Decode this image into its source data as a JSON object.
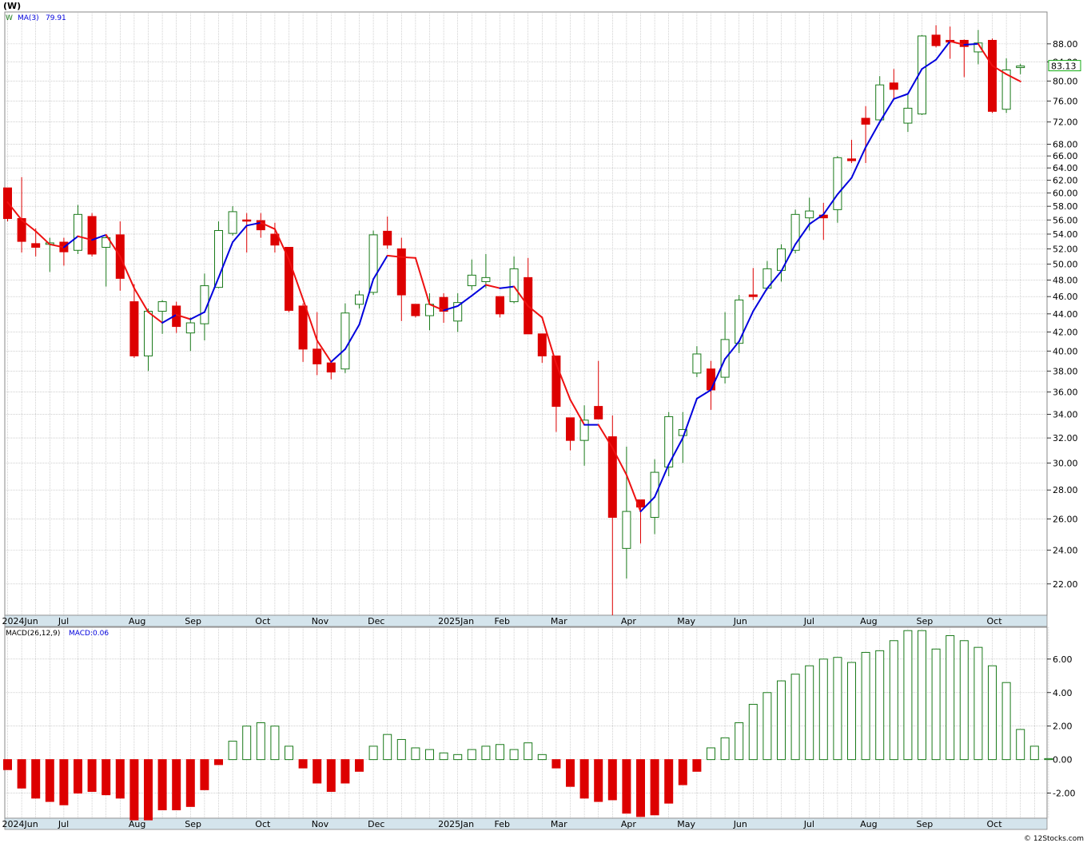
{
  "chart_data": {
    "type": "candlestick",
    "ticker": "(W)",
    "colors": {
      "up": "#1a7a1a",
      "down": "#dd0000",
      "ma_up": "#0000dd",
      "ma_down": "#ee1111",
      "macd_pos": "#1a7a1a",
      "macd_neg": "#dd0000",
      "grid": "#b4b4b4",
      "axis_bar": "#d4e4ec",
      "price_tag": "#11aa11"
    },
    "price_panel": {
      "legend": {
        "symbol": "W",
        "ma_label": "MA(3)",
        "ma_value": "79.91"
      },
      "y_scale": "log",
      "y_range": [
        20.3,
        95.5
      ],
      "y_ticks": [
        "22.00",
        "24.00",
        "26.00",
        "28.00",
        "30.00",
        "32.00",
        "34.00",
        "36.00",
        "38.00",
        "40.00",
        "42.00",
        "44.00",
        "46.00",
        "48.00",
        "50.00",
        "52.00",
        "54.00",
        "56.00",
        "58.00",
        "60.00",
        "62.00",
        "64.00",
        "66.00",
        "68.00",
        "72.00",
        "76.00",
        "80.00",
        "84.00",
        "88.00"
      ],
      "last_price": "83.13",
      "x_labels": [
        {
          "text": "2024Jun",
          "i": 0
        },
        {
          "text": "Jul",
          "i": 4
        },
        {
          "text": "Aug",
          "i": 9
        },
        {
          "text": "Sep",
          "i": 13
        },
        {
          "text": "Oct",
          "i": 18
        },
        {
          "text": "Nov",
          "i": 22
        },
        {
          "text": "Dec",
          "i": 26
        },
        {
          "text": "2025Jan",
          "i": 31
        },
        {
          "text": "Feb",
          "i": 35
        },
        {
          "text": "Mar",
          "i": 39
        },
        {
          "text": "Apr",
          "i": 44
        },
        {
          "text": "May",
          "i": 48
        },
        {
          "text": "Jun",
          "i": 52
        },
        {
          "text": "Jul",
          "i": 57
        },
        {
          "text": "Aug",
          "i": 61
        },
        {
          "text": "Sep",
          "i": 65
        },
        {
          "text": "Oct",
          "i": 70
        }
      ],
      "candles": [
        {
          "o": 60.8,
          "h": 60.8,
          "l": 55.8,
          "c": 56.2
        },
        {
          "o": 56.2,
          "h": 62.5,
          "l": 51.5,
          "c": 53.0
        },
        {
          "o": 52.7,
          "h": 54.8,
          "l": 51.0,
          "c": 52.2
        },
        {
          "o": 52.6,
          "h": 53.5,
          "l": 49.0,
          "c": 52.8
        },
        {
          "o": 52.9,
          "h": 53.5,
          "l": 49.8,
          "c": 51.6
        },
        {
          "o": 51.8,
          "h": 58.2,
          "l": 51.3,
          "c": 56.8
        },
        {
          "o": 56.5,
          "h": 57.0,
          "l": 51.0,
          "c": 51.3
        },
        {
          "o": 52.2,
          "h": 54.0,
          "l": 47.2,
          "c": 53.5
        },
        {
          "o": 53.9,
          "h": 55.8,
          "l": 46.7,
          "c": 48.2
        },
        {
          "o": 45.4,
          "h": 47.5,
          "l": 39.3,
          "c": 39.5
        },
        {
          "o": 39.5,
          "h": 44.6,
          "l": 38.0,
          "c": 44.3
        },
        {
          "o": 44.3,
          "h": 45.6,
          "l": 41.8,
          "c": 45.4
        },
        {
          "o": 44.9,
          "h": 45.4,
          "l": 41.9,
          "c": 42.6
        },
        {
          "o": 41.9,
          "h": 43.6,
          "l": 40.0,
          "c": 43.0
        },
        {
          "o": 42.9,
          "h": 48.8,
          "l": 41.1,
          "c": 47.3
        },
        {
          "o": 47.1,
          "h": 55.8,
          "l": 47.0,
          "c": 54.5
        },
        {
          "o": 54.1,
          "h": 58.0,
          "l": 53.8,
          "c": 57.2
        },
        {
          "o": 56.0,
          "h": 57.0,
          "l": 51.5,
          "c": 55.9
        },
        {
          "o": 55.9,
          "h": 57.0,
          "l": 53.5,
          "c": 54.6
        },
        {
          "o": 54.0,
          "h": 55.6,
          "l": 51.5,
          "c": 52.5
        },
        {
          "o": 52.2,
          "h": 52.2,
          "l": 44.2,
          "c": 44.4
        },
        {
          "o": 44.9,
          "h": 45.2,
          "l": 38.9,
          "c": 40.2
        },
        {
          "o": 40.2,
          "h": 44.2,
          "l": 37.6,
          "c": 38.7
        },
        {
          "o": 38.8,
          "h": 38.9,
          "l": 37.2,
          "c": 37.9
        },
        {
          "o": 38.2,
          "h": 45.2,
          "l": 37.8,
          "c": 44.1
        },
        {
          "o": 45.1,
          "h": 46.7,
          "l": 44.6,
          "c": 46.2
        },
        {
          "o": 46.5,
          "h": 54.5,
          "l": 46.2,
          "c": 53.9
        },
        {
          "o": 54.4,
          "h": 56.5,
          "l": 52.0,
          "c": 52.5
        },
        {
          "o": 52.0,
          "h": 53.5,
          "l": 43.2,
          "c": 46.2
        },
        {
          "o": 45.1,
          "h": 45.1,
          "l": 43.6,
          "c": 43.8
        },
        {
          "o": 43.8,
          "h": 46.4,
          "l": 42.2,
          "c": 45.1
        },
        {
          "o": 45.9,
          "h": 46.4,
          "l": 43.0,
          "c": 44.3
        },
        {
          "o": 43.2,
          "h": 46.4,
          "l": 42.0,
          "c": 45.3
        },
        {
          "o": 47.3,
          "h": 50.6,
          "l": 46.8,
          "c": 48.6
        },
        {
          "o": 47.8,
          "h": 51.3,
          "l": 47.0,
          "c": 48.3
        },
        {
          "o": 46.0,
          "h": 46.0,
          "l": 43.6,
          "c": 44.0
        },
        {
          "o": 45.4,
          "h": 51.0,
          "l": 45.2,
          "c": 49.4
        },
        {
          "o": 48.3,
          "h": 50.8,
          "l": 41.8,
          "c": 41.8
        },
        {
          "o": 41.8,
          "h": 41.8,
          "l": 38.8,
          "c": 39.5
        },
        {
          "o": 39.5,
          "h": 39.5,
          "l": 32.5,
          "c": 34.7
        },
        {
          "o": 33.7,
          "h": 33.7,
          "l": 31.0,
          "c": 31.8
        },
        {
          "o": 31.8,
          "h": 34.8,
          "l": 29.8,
          "c": 33.5
        },
        {
          "o": 34.7,
          "h": 39.0,
          "l": 33.6,
          "c": 33.6
        },
        {
          "o": 32.1,
          "h": 33.9,
          "l": 20.3,
          "c": 26.1
        },
        {
          "o": 24.1,
          "h": 31.3,
          "l": 22.3,
          "c": 26.5
        },
        {
          "o": 27.3,
          "h": 27.3,
          "l": 24.4,
          "c": 26.8
        },
        {
          "o": 26.1,
          "h": 30.3,
          "l": 25.0,
          "c": 29.3
        },
        {
          "o": 29.7,
          "h": 34.2,
          "l": 29.0,
          "c": 33.8
        },
        {
          "o": 32.2,
          "h": 34.2,
          "l": 30.0,
          "c": 32.7
        },
        {
          "o": 37.8,
          "h": 40.5,
          "l": 37.4,
          "c": 39.7
        },
        {
          "o": 38.2,
          "h": 39.0,
          "l": 34.4,
          "c": 36.2
        },
        {
          "o": 37.4,
          "h": 44.2,
          "l": 36.8,
          "c": 41.2
        },
        {
          "o": 40.8,
          "h": 46.2,
          "l": 39.8,
          "c": 45.6
        },
        {
          "o": 46.2,
          "h": 49.5,
          "l": 45.6,
          "c": 46.0
        },
        {
          "o": 47.0,
          "h": 50.4,
          "l": 46.8,
          "c": 49.4
        },
        {
          "o": 49.2,
          "h": 52.6,
          "l": 47.8,
          "c": 52.0
        },
        {
          "o": 51.8,
          "h": 57.5,
          "l": 51.4,
          "c": 56.8
        },
        {
          "o": 56.3,
          "h": 59.3,
          "l": 54.5,
          "c": 57.3
        },
        {
          "o": 56.7,
          "h": 58.5,
          "l": 53.2,
          "c": 56.3
        },
        {
          "o": 57.5,
          "h": 66.0,
          "l": 55.6,
          "c": 65.7
        },
        {
          "o": 65.5,
          "h": 68.8,
          "l": 64.8,
          "c": 65.2
        },
        {
          "o": 72.7,
          "h": 75.0,
          "l": 64.8,
          "c": 71.6
        },
        {
          "o": 72.4,
          "h": 81.0,
          "l": 72.3,
          "c": 79.2
        },
        {
          "o": 79.6,
          "h": 82.5,
          "l": 76.5,
          "c": 78.3
        },
        {
          "o": 71.8,
          "h": 77.2,
          "l": 70.2,
          "c": 74.6
        },
        {
          "o": 73.5,
          "h": 90.0,
          "l": 73.3,
          "c": 89.8
        },
        {
          "o": 90.0,
          "h": 92.3,
          "l": 87.2,
          "c": 87.6
        },
        {
          "o": 88.8,
          "h": 92.0,
          "l": 84.7,
          "c": 88.4
        },
        {
          "o": 88.8,
          "h": 89.0,
          "l": 80.8,
          "c": 87.4
        },
        {
          "o": 86.2,
          "h": 91.2,
          "l": 83.5,
          "c": 88.2
        },
        {
          "o": 88.8,
          "h": 89.2,
          "l": 73.7,
          "c": 74.0
        },
        {
          "o": 74.4,
          "h": 84.8,
          "l": 73.7,
          "c": 82.3
        },
        {
          "o": 82.8,
          "h": 83.6,
          "l": 81.4,
          "c": 83.13
        }
      ],
      "ma3": [
        58.6,
        56.0,
        54.4,
        52.6,
        52.2,
        53.7,
        53.2,
        53.9,
        51.0,
        47.0,
        44.2,
        43.0,
        43.9,
        43.4,
        44.2,
        48.3,
        52.9,
        55.2,
        55.6,
        54.7,
        50.6,
        45.7,
        41.1,
        38.9,
        40.2,
        42.8,
        48.1,
        51.1,
        50.9,
        50.8,
        45.1,
        44.4,
        44.9,
        46.1,
        47.4,
        47.0,
        47.2,
        44.9,
        43.6,
        38.7,
        35.3,
        33.1,
        33.1,
        31.2,
        29.1,
        26.5,
        27.5,
        29.9,
        32.0,
        35.4,
        36.2,
        39.2,
        41.0,
        44.3,
        47.0,
        49.1,
        52.6,
        55.4,
        56.8,
        59.8,
        62.4,
        67.5,
        72.0,
        76.4,
        77.4,
        82.5,
        84.5,
        88.6,
        87.8,
        88.0,
        83.2,
        81.4,
        79.91
      ],
      "ma_color_switch_index": 68
    },
    "macd_panel": {
      "label": "MACD(26,12,9)",
      "value_label": "MACD:0.06",
      "y_range": [
        -3.5,
        7.9
      ],
      "y_ticks": [
        "-2.00",
        "0.00",
        "2.00",
        "4.00",
        "6.00"
      ],
      "y_tick_values": [
        -2,
        0,
        2,
        4,
        6
      ],
      "values": [
        -0.6,
        -1.7,
        -2.3,
        -2.5,
        -2.7,
        -2.0,
        -1.9,
        -2.1,
        -2.3,
        -3.6,
        -3.6,
        -3.0,
        -3.0,
        -2.8,
        -1.8,
        -0.3,
        1.1,
        2.0,
        2.2,
        2.0,
        0.8,
        -0.5,
        -1.4,
        -1.9,
        -1.4,
        -0.7,
        0.8,
        1.5,
        1.2,
        0.7,
        0.6,
        0.4,
        0.3,
        0.6,
        0.8,
        0.9,
        0.6,
        1.0,
        0.3,
        -0.5,
        -1.6,
        -2.3,
        -2.5,
        -2.4,
        -3.2,
        -3.4,
        -3.3,
        -2.6,
        -1.5,
        -0.7,
        0.7,
        1.3,
        2.2,
        3.3,
        4.0,
        4.7,
        5.1,
        5.6,
        6.0,
        6.1,
        5.8,
        6.4,
        6.5,
        7.1,
        7.7,
        7.7,
        6.6,
        7.4,
        7.1,
        6.7,
        5.6,
        4.6,
        1.8,
        0.8,
        0.06
      ]
    },
    "footer": {
      "watermark": "© 12Stocks.com"
    }
  }
}
